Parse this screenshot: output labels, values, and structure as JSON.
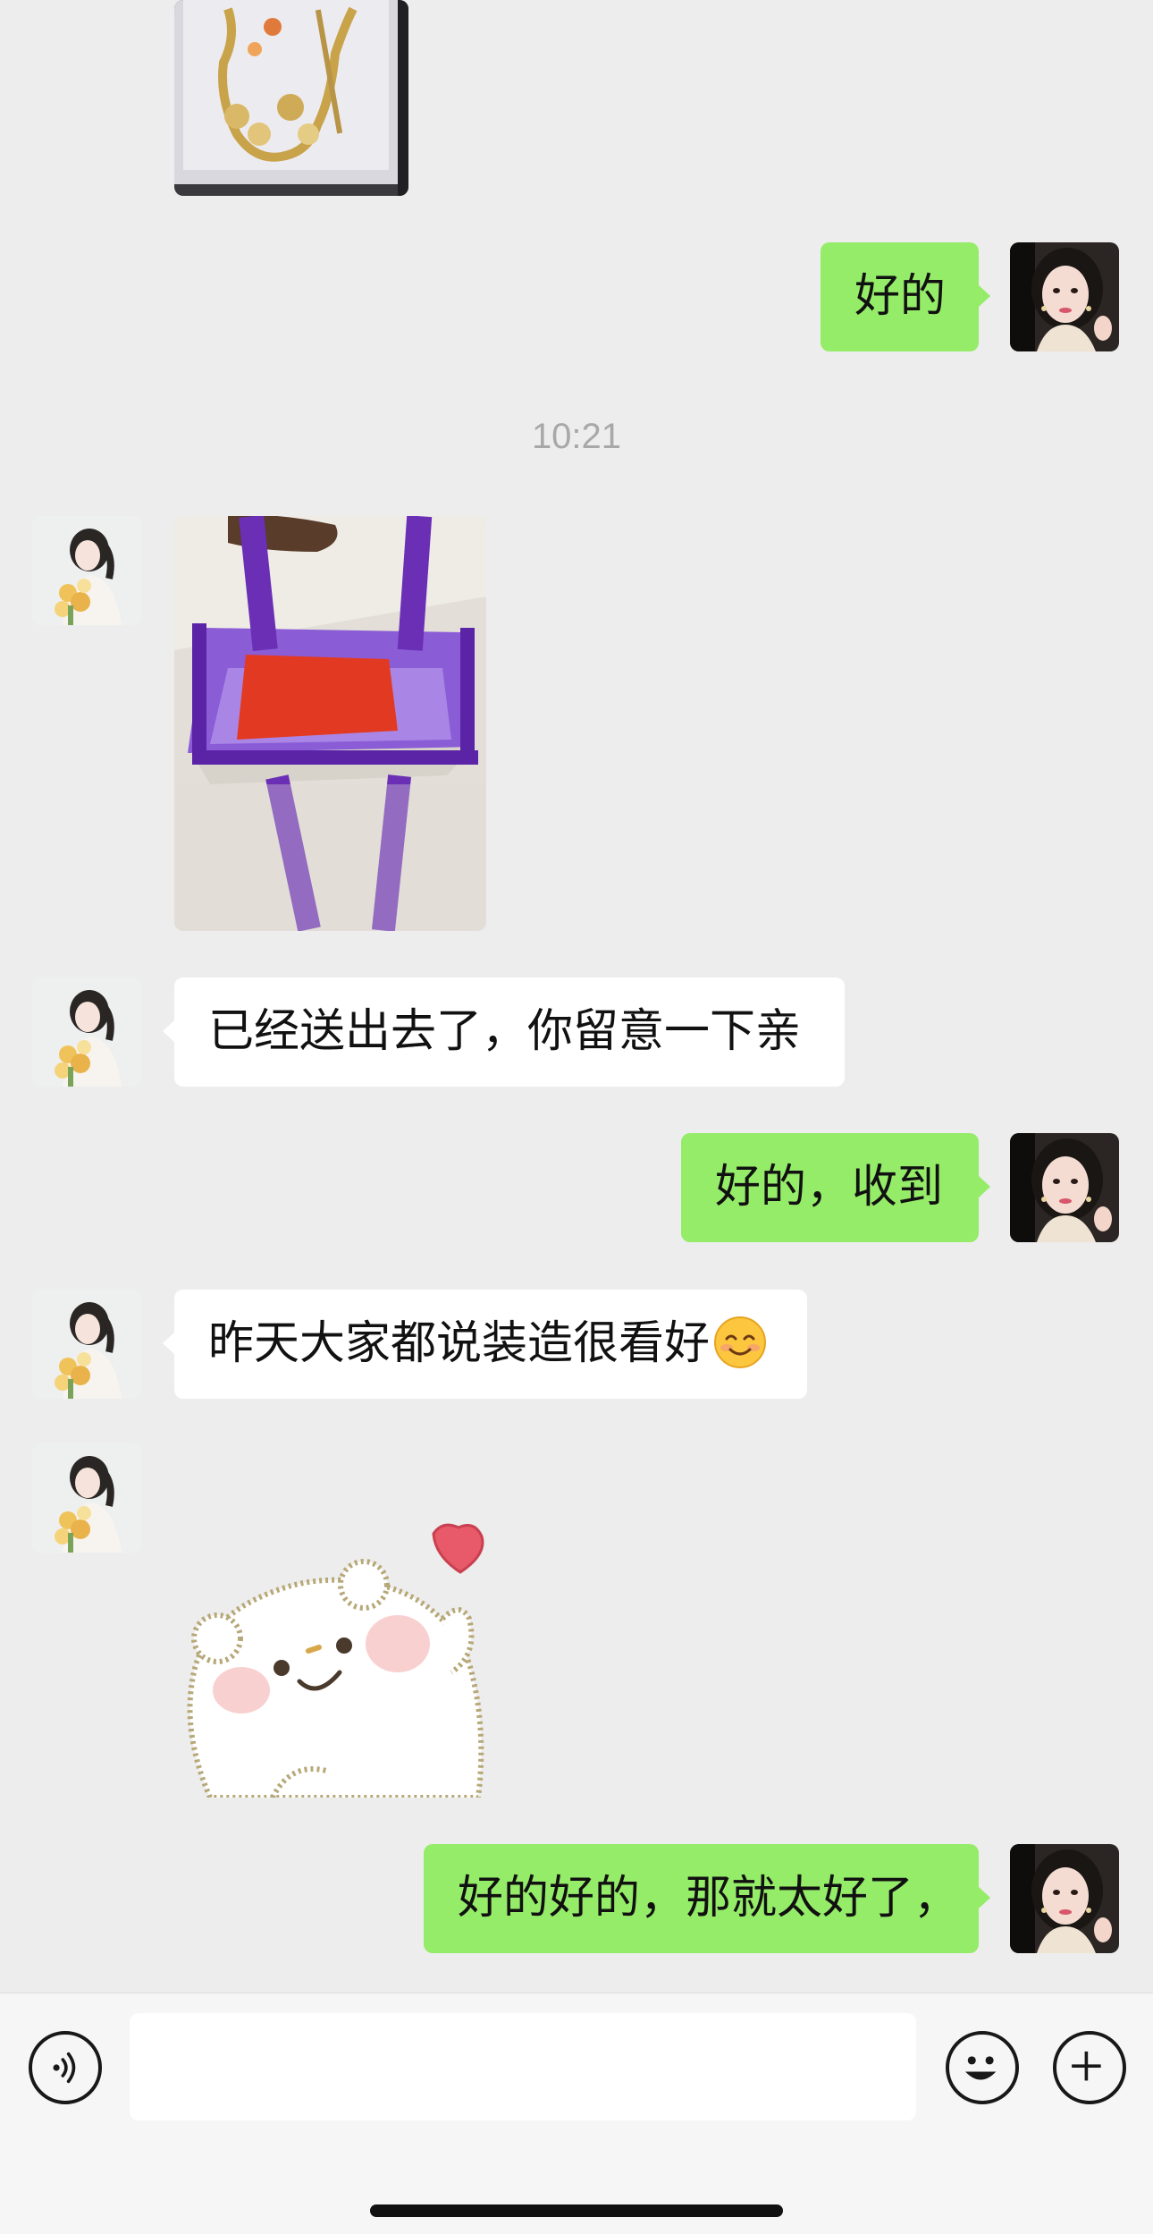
{
  "chat": {
    "timestamp": "10:21",
    "messages": [
      {
        "from": "me",
        "type": "text",
        "text": "好的"
      },
      {
        "from": "them",
        "type": "image",
        "description": "purple bag with red envelope"
      },
      {
        "from": "them",
        "type": "text",
        "text": "已经送出去了，你留意一下亲"
      },
      {
        "from": "me",
        "type": "text",
        "text": "好的，收到"
      },
      {
        "from": "them",
        "type": "text",
        "text": "昨天大家都说装造很看好",
        "emoji": "smiling-face"
      },
      {
        "from": "them",
        "type": "sticker",
        "description": "white bear with heart"
      },
      {
        "from": "me",
        "type": "text",
        "text": "好的好的，那就太好了，"
      }
    ]
  },
  "input": {
    "value": "",
    "left_icon": "voice-icon",
    "right_icons": [
      "emoji-icon",
      "plus-icon"
    ]
  },
  "colors": {
    "background": "#ededed",
    "my_bubble": "#95ec69",
    "their_bubble": "#ffffff",
    "timestamp_text": "#a8a8a8"
  }
}
